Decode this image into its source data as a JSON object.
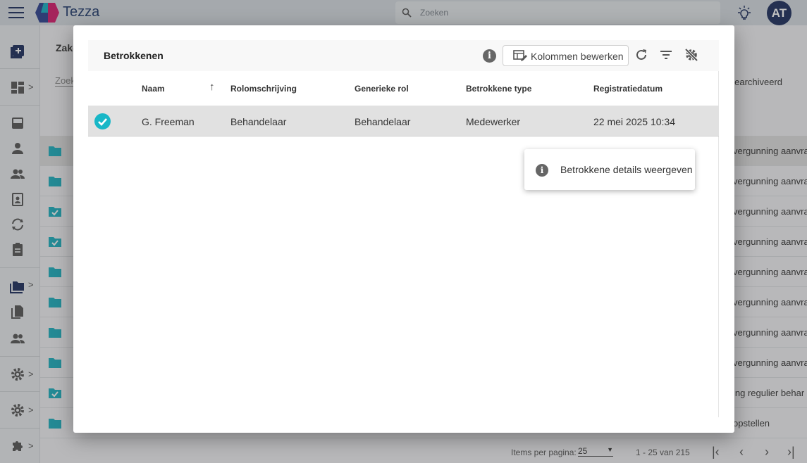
{
  "app": {
    "brand": "Tezza",
    "search_placeholder": "Zoeken",
    "avatar_initials": "AT"
  },
  "background": {
    "page_title": "Zake",
    "search_label": "Zoek",
    "archived_toggle": "Gearchiveerd",
    "rows": [
      {
        "icon": "folder-icon",
        "text": "vergunning aanvra"
      },
      {
        "icon": "folder-icon",
        "text": "vergunning aanvra"
      },
      {
        "icon": "folder-check-icon",
        "text": "vergunning aanvra"
      },
      {
        "icon": "folder-check-icon",
        "text": "vergunning aanvra"
      },
      {
        "icon": "folder-icon",
        "text": "vergunning aanvra"
      },
      {
        "icon": "folder-icon",
        "text": "vergunning aanvra"
      },
      {
        "icon": "folder-icon",
        "text": "vergunning aanvra"
      },
      {
        "icon": "folder-icon",
        "text": "vergunning aanvra"
      },
      {
        "icon": "folder-check-icon",
        "text": "ing regulier behar"
      },
      {
        "icon": "folder-icon",
        "text": "opstellen"
      }
    ],
    "pager": {
      "items_per_page_label": "Items per pagina:",
      "items_per_page": "25",
      "range": "1 - 25 van 215"
    }
  },
  "dialog": {
    "title": "Betrokkenen",
    "columns_button": "Kolommen bewerken",
    "columns": [
      "Naam",
      "Rolomschrijving",
      "Generieke rol",
      "Betrokkene type",
      "Registratiedatum"
    ],
    "rows": [
      {
        "naam": "G. Freeman",
        "rolomschrijving": "Behandelaar",
        "generieke_rol": "Behandelaar",
        "type": "Medewerker",
        "datum": "22 mei 2025 10:34"
      }
    ],
    "context_menu": {
      "item_label": "Betrokkene details weergeven"
    }
  },
  "colors": {
    "accent": "#18b7c7",
    "brand": "#1a2b5c",
    "folder": "#1ab0c0"
  }
}
